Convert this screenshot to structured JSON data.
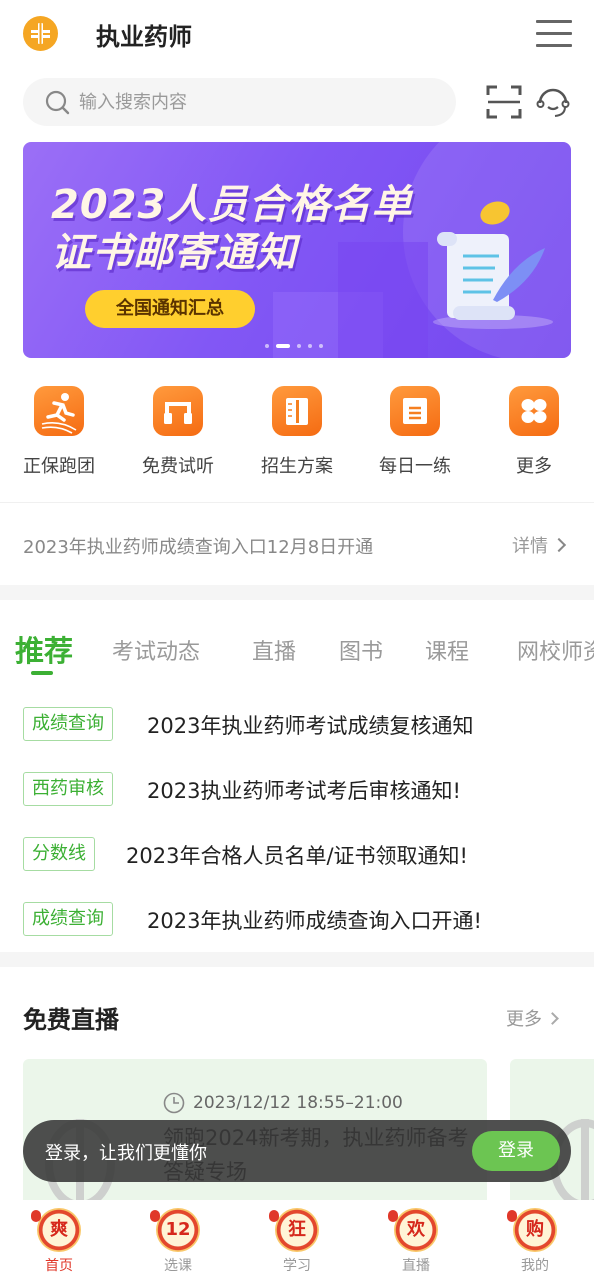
{
  "header": {
    "title": "执业药师",
    "logo_icon": "plus-cross-logo",
    "menu_icon": "hamburger-menu-icon"
  },
  "search": {
    "placeholder": "输入搜索内容",
    "value": "",
    "scan_icon": "scan-icon",
    "service_icon": "customer-service-icon"
  },
  "banner": {
    "line1": "2023人员合格名单",
    "line2": "证书邮寄通知",
    "button_label": "全国通知汇总",
    "slide_count": 5,
    "active_slide": 2
  },
  "quick_links": [
    {
      "label": "正保跑团",
      "icon": "runner-icon"
    },
    {
      "label": "免费试听",
      "icon": "headphones-icon"
    },
    {
      "label": "招生方案",
      "icon": "book-icon"
    },
    {
      "label": "每日一练",
      "icon": "notepad-icon"
    },
    {
      "label": "更多",
      "icon": "grid-more-icon"
    }
  ],
  "notice": {
    "text": "2023年执业药师成绩查询入口12月8日开通",
    "more_label": "详情"
  },
  "tabs": [
    {
      "label": "推荐",
      "active": true
    },
    {
      "label": "考试动态",
      "active": false
    },
    {
      "label": "直播",
      "active": false
    },
    {
      "label": "图书",
      "active": false
    },
    {
      "label": "课程",
      "active": false
    },
    {
      "label": "网校师资",
      "active": false
    }
  ],
  "news": [
    {
      "tag": "成绩查询",
      "title": "2023年执业药师考试成绩复核通知"
    },
    {
      "tag": "西药审核",
      "title": "2023执业药师考试考后审核通知!"
    },
    {
      "tag": "分数线",
      "title": "2023年合格人员名单/证书领取通知!"
    },
    {
      "tag": "成绩查询",
      "title": "2023年执业药师成绩查询入口开通!"
    }
  ],
  "free_live": {
    "title": "免费直播",
    "more_label": "更多",
    "cards": [
      {
        "time": "2023/12/12 18:55–21:00",
        "title": "领跑2024新考期，执业药师备考答疑专场"
      }
    ]
  },
  "toast": {
    "text": "登录，让我们更懂你",
    "button_label": "登录"
  },
  "bottom_nav": [
    {
      "label": "首页",
      "badge": "爽",
      "active": true
    },
    {
      "label": "选课",
      "badge": "12",
      "active": false
    },
    {
      "label": "学习",
      "badge": "狂",
      "active": false
    },
    {
      "label": "直播",
      "badge": "欢",
      "active": false
    },
    {
      "label": "我的",
      "badge": "购",
      "active": false
    }
  ],
  "colors": {
    "brand_green": "#3cb034",
    "orange": "#f56b12",
    "banner_purple": "#8257f5",
    "active_nav_red": "#e0382a"
  }
}
